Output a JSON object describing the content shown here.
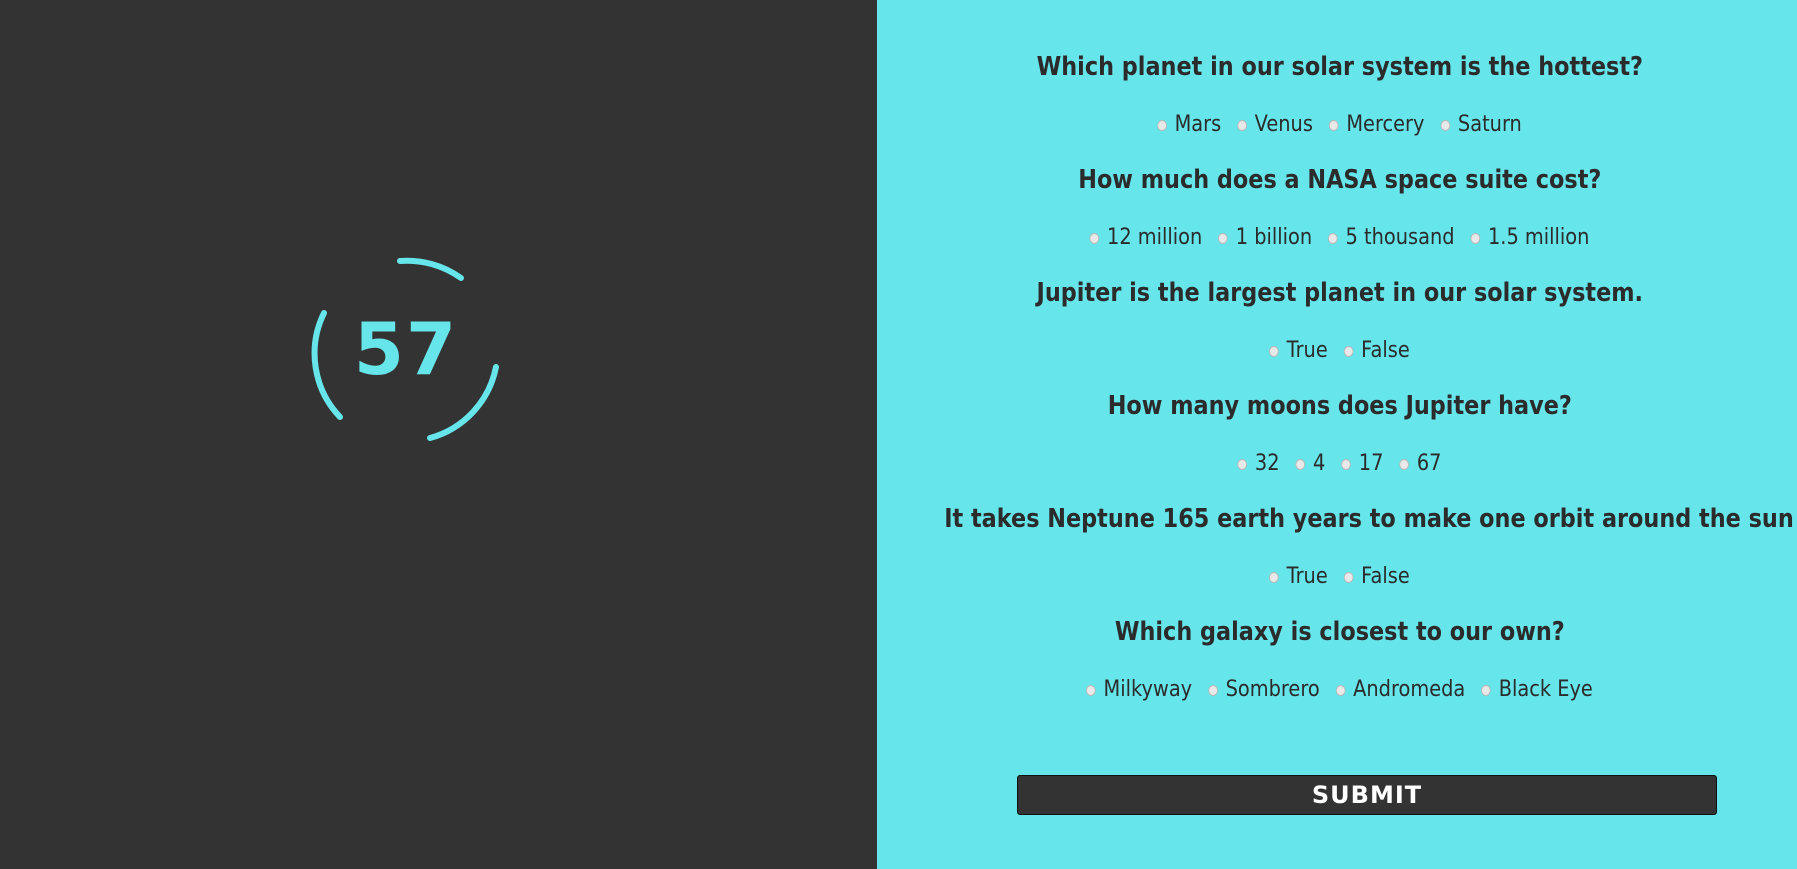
{
  "colors": {
    "left_bg": "#333333",
    "right_bg": "#66e5ea",
    "accent": "#66e5ea",
    "text": "#2b2b2b",
    "button_bg": "#333333",
    "button_text": "#ffffff"
  },
  "timer": {
    "value": "57"
  },
  "quiz": {
    "questions": [
      {
        "text": "Which planet in our solar system is the hottest?",
        "options": [
          "Mars",
          "Venus",
          "Mercery",
          "Saturn"
        ]
      },
      {
        "text": "How much does a NASA space suite cost?",
        "options": [
          "12 million",
          "1 billion",
          "5 thousand",
          "1.5 million"
        ]
      },
      {
        "text": "Jupiter is the largest planet in our solar system.",
        "options": [
          "True",
          "False"
        ]
      },
      {
        "text": "How many moons does Jupiter have?",
        "options": [
          "32",
          "4",
          "17",
          "67"
        ]
      },
      {
        "text": "It takes Neptune 165 earth years to make one orbit around the sun",
        "options": [
          "True",
          "False"
        ]
      },
      {
        "text": "Which galaxy is closest to our own?",
        "options": [
          "Milkyway",
          "Sombrero",
          "Andromeda",
          "Black Eye"
        ]
      }
    ],
    "submit_label": "SUBMIT"
  }
}
